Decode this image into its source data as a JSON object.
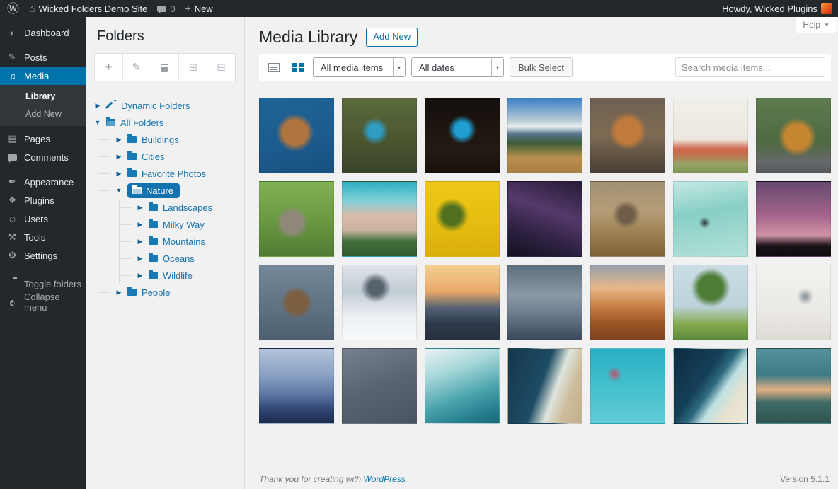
{
  "admin_bar": {
    "site_name": "Wicked Folders Demo Site",
    "comments_count": "0",
    "new_label": "New",
    "howdy": "Howdy, Wicked Plugins"
  },
  "icons": {
    "wp_logo": "Ⓦ",
    "home": "⌂",
    "plus": "+",
    "dashboard": "◐",
    "posts": "✎",
    "media": "♫",
    "pages": "▤",
    "appearance": "✒",
    "plugins": "❖",
    "users": "☺",
    "tools": "⚒",
    "settings": "⚙",
    "collapse": "◀",
    "caret_closed": "▶",
    "caret_open": "▼",
    "select_caret": "▾",
    "help_caret": "▼",
    "add_folder": "+",
    "edit_folder": "✎",
    "expand_all": "⊞",
    "collapse_all": "⊟"
  },
  "sidebar": {
    "dashboard": "Dashboard",
    "posts": "Posts",
    "media": "Media",
    "library": "Library",
    "add_new": "Add New",
    "pages": "Pages",
    "comments": "Comments",
    "appearance": "Appearance",
    "plugins": "Plugins",
    "users": "Users",
    "tools": "Tools",
    "settings": "Settings",
    "toggle_folders": "Toggle folders",
    "collapse_menu": "Collapse menu"
  },
  "folders_panel": {
    "title": "Folders"
  },
  "folder_tree": {
    "dynamic": "Dynamic Folders",
    "all_folders": "All Folders",
    "buildings": "Buildings",
    "cities": "Cities",
    "favorite_photos": "Favorite Photos",
    "nature": "Nature",
    "landscapes": "Landscapes",
    "milky_way": "Milky Way",
    "mountains": "Mountains",
    "oceans": "Oceans",
    "wildlife": "Wildlife",
    "people": "People"
  },
  "main": {
    "title": "Media Library",
    "add_new": "Add New",
    "help": "Help",
    "media_type_filter": "All media items",
    "date_filter": "All dates",
    "bulk_select": "Bulk Select",
    "search_placeholder": "Search media items..."
  },
  "colors": {
    "accent": "#0073aa",
    "admin_bar_bg": "#23282d",
    "submenu_bg": "#32373c",
    "page_bg": "#f1f1f1",
    "folder_link": "#1571ae",
    "selected_folder_bg": "#1373ae"
  },
  "media_grid": {
    "photos": [
      {
        "name": "sea-turtle",
        "angle": 165,
        "colors": [
          "#1e6496",
          "#1d5c8e 55%",
          "#174f7e"
        ],
        "accent": "#b0743e",
        "accent_pos": "48% 46%",
        "accent_size": 28
      },
      {
        "name": "kingfisher",
        "colors": [
          "#5a6a3c",
          "#49542f 60%",
          "#3a442a"
        ],
        "accent": "#2f9cc3",
        "accent_pos": "44% 44%",
        "accent_size": 17
      },
      {
        "name": "glowing-canyon",
        "colors": [
          "#140f0d",
          "#241a12 70%",
          "#17100c"
        ],
        "accent": "#1f9ed2",
        "accent_pos": "50% 42%",
        "accent_size": 19
      },
      {
        "name": "mountain-valley",
        "colors": [
          "#3c80c4",
          "#b9cbd6 30%",
          "#e8eef0 38%",
          "#56748c 48%",
          "#3e5c38 60%",
          "#b9904f 80%",
          "#a87e42"
        ]
      },
      {
        "name": "fox",
        "colors": [
          "#6f6152",
          "#7d6a52 50%",
          "#4a4036"
        ],
        "accent": "#c07a3c",
        "accent_pos": "50% 44%",
        "accent_size": 28
      },
      {
        "name": "poppy-meadow",
        "colors": [
          "#f1efe9",
          "#ece8df 55%",
          "#d2694c 68%",
          "#c2714f 76%",
          "#97a468 88%",
          "#7e9456"
        ]
      },
      {
        "name": "tiger",
        "colors": [
          "#5d7b4e",
          "#4f6a43 60%",
          "#66686a 85%",
          "#565a5c"
        ],
        "accent": "#c58531",
        "accent_pos": "55% 52%",
        "accent_size": 28
      },
      {
        "name": "owl",
        "colors": [
          "#82b054",
          "#689740 55%",
          "#507c34"
        ],
        "accent": "#90887a",
        "accent_pos": "44% 55%",
        "accent_size": 23
      },
      {
        "name": "sand-dune",
        "colors": [
          "#2fb0c2",
          "#7fd0d8 25%",
          "#d8bca9 45%",
          "#cbb39f 65%",
          "#41703a 80%",
          "#2f5c2e"
        ]
      },
      {
        "name": "sunflower",
        "colors": [
          "#eec916",
          "#e5bc10 60%",
          "#d9ae0a"
        ],
        "accent": "#50701f",
        "accent_pos": "36% 45%",
        "accent_size": 21
      },
      {
        "name": "milky-way",
        "angle": 200,
        "colors": [
          "#241b36",
          "#55396b 40%",
          "#2c2040 72%",
          "#141020"
        ]
      },
      {
        "name": "elephants",
        "colors": [
          "#a09177",
          "#b59c76 40%",
          "#9c7f52 70%",
          "#7c6236"
        ],
        "accent": "#6f5d48",
        "accent_pos": "48% 44%",
        "accent_size": 19
      },
      {
        "name": "soaring-bird",
        "angle": 170,
        "colors": [
          "#c5e9e3",
          "#87cfc5 40%",
          "#9ed8cf 70%",
          "#b2e0da"
        ],
        "accent": "#2e3b38",
        "accent_pos": "42% 55%",
        "accent_size": 4
      },
      {
        "name": "violet-dusk",
        "colors": [
          "#65486f",
          "#a5648c 45%",
          "#cf93a6 72%",
          "#1a1218 86%",
          "#100c10"
        ]
      },
      {
        "name": "forest-canopy",
        "colors": [
          "#75889a",
          "#5d7183 60%",
          "#4d5f70"
        ],
        "accent": "#7c5e40",
        "accent_pos": "50% 50%",
        "accent_size": 25
      },
      {
        "name": "snowy-peaks",
        "colors": [
          "#dfe5ea",
          "#c2ccd4 35%",
          "#eef1f4 70%",
          "#f6f8f9"
        ],
        "accent": "#58626c",
        "accent_pos": "45% 30%",
        "accent_size": 17
      },
      {
        "name": "sunrise-forest",
        "colors": [
          "#f3cf92",
          "#eaa968 35%",
          "#516073 58%",
          "#2e3a4b 78%",
          "#27303f"
        ]
      },
      {
        "name": "foggy-fjord",
        "colors": [
          "#5d6e7e",
          "#8b98a6 40%",
          "#6b7c8c 65%",
          "#39485a"
        ]
      },
      {
        "name": "sunset-ridges",
        "colors": [
          "#97a0ab",
          "#e6b789 30%",
          "#c97f44 55%",
          "#9c5526 78%",
          "#7e421e"
        ]
      },
      {
        "name": "lone-tree",
        "colors": [
          "#cadde4",
          "#bcd3da 55%",
          "#83a94e 80%",
          "#5c8a3c"
        ],
        "accent": "#4d7c36",
        "accent_pos": "50% 30%",
        "accent_size": 25
      },
      {
        "name": "statue-of-liberty",
        "colors": [
          "#f3f2ef",
          "#ebe9e5 60%",
          "#dfdcd6"
        ],
        "accent": "#8d969e",
        "accent_pos": "66% 42%",
        "accent_size": 7
      },
      {
        "name": "misty-blue-mountains",
        "colors": [
          "#b3c3da",
          "#8ba2c6 35%",
          "#5b74a0 62%",
          "#2e4572 82%",
          "#1c2c50"
        ]
      },
      {
        "name": "fish-school",
        "angle": 160,
        "colors": [
          "#77808f",
          "#5a6374 50%",
          "#4a5364"
        ]
      },
      {
        "name": "curling-wave",
        "angle": 160,
        "colors": [
          "#eaf2f3",
          "#a8d8da 30%",
          "#4aa4ad 62%",
          "#247d8d 85%",
          "#1b6a7a"
        ]
      },
      {
        "name": "aerial-beach",
        "angle": 110,
        "colors": [
          "#16364b",
          "#1d4c65 45%",
          "#dfe5dd 62%",
          "#cdbd9d 78%",
          "#c3ac8a"
        ]
      },
      {
        "name": "hot-air-balloons",
        "colors": [
          "#27b0c3",
          "#49c2cf 60%",
          "#62cdd6"
        ],
        "accent": "#c2536b",
        "accent_pos": "32% 34%",
        "accent_size": 5
      },
      {
        "name": "aerial-turtle",
        "angle": 125,
        "colors": [
          "#0e2b40",
          "#154059 40%",
          "#2d6b80 52%",
          "#bfe1e2 63%",
          "#e7e2cf 78%",
          "#efe9d8"
        ]
      },
      {
        "name": "yosemite-valley",
        "colors": [
          "#53929c",
          "#3d7a86 35%",
          "#e2b184 55%",
          "#3f6b66 72%",
          "#2e544e"
        ]
      }
    ]
  },
  "footer": {
    "thanks_prefix": "Thank you for creating with ",
    "wordpress_link": "WordPress",
    "thanks_suffix": ".",
    "version": "Version 5.1.1"
  }
}
